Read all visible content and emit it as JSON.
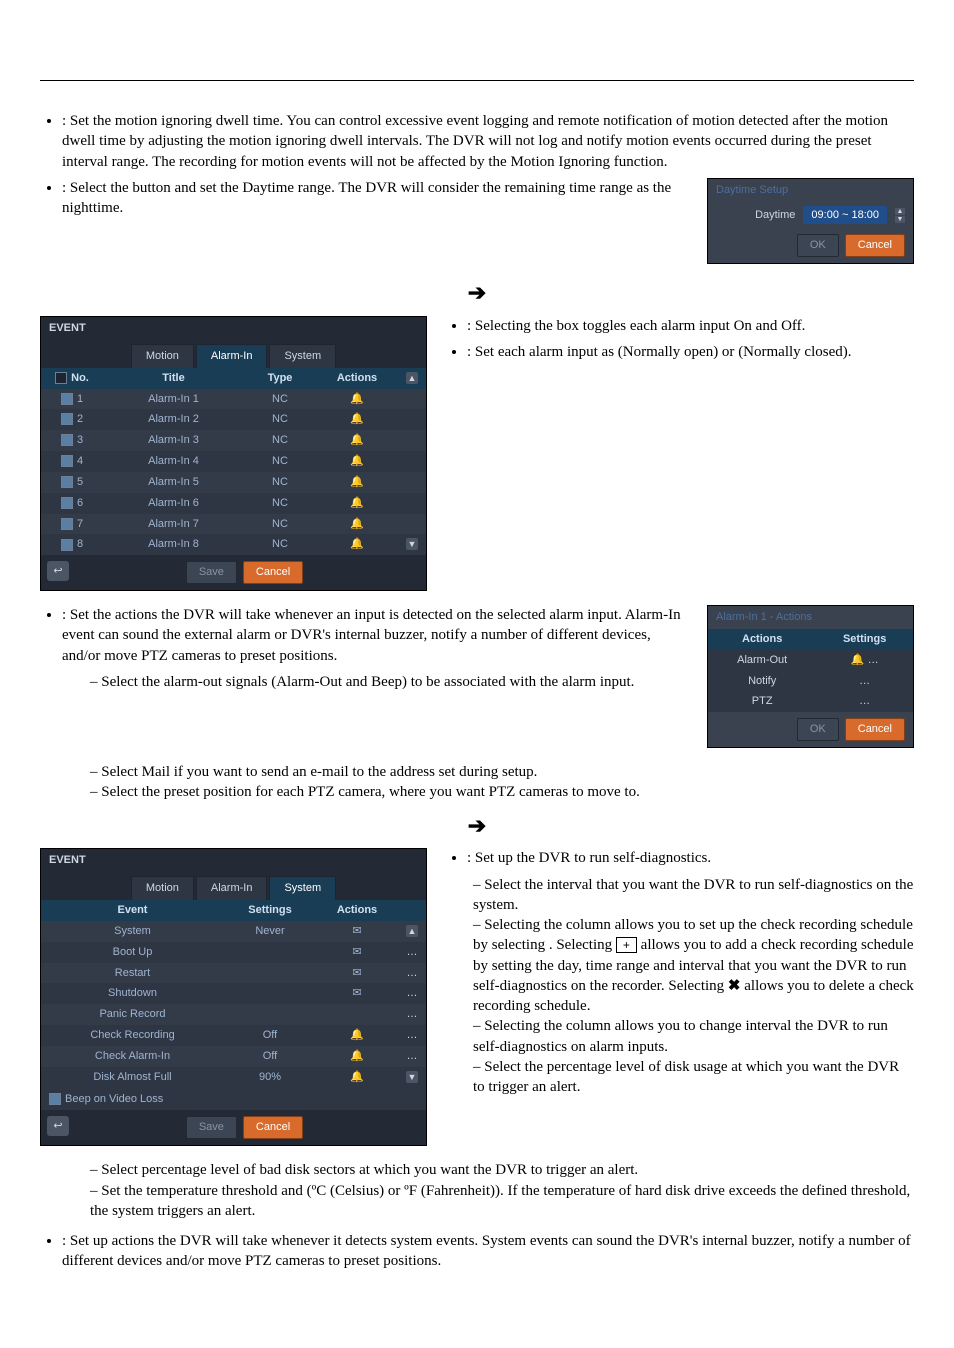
{
  "top": {
    "ignoring_text": ":  Set the motion ignoring dwell time.  You can control excessive event logging and remote notification of motion detected after the motion dwell time by adjusting the motion ignoring dwell intervals.  The DVR will not log and notify motion events occurred during the preset interval range.  The recording for motion events will not be affected by the Motion Ignoring function.",
    "daytime_text": ": Select the button and set the Daytime range.  The DVR will consider the remaining time range as the nighttime."
  },
  "daytime_panel": {
    "title": "Daytime Setup",
    "label": "Daytime",
    "value": "09:00 ~ 18:00",
    "ok": "OK",
    "cancel": "Cancel"
  },
  "alarmin_panel": {
    "title": "EVENT",
    "tabs": [
      "Motion",
      "Alarm-In",
      "System"
    ],
    "active_tab": 1,
    "cols": {
      "no": "No.",
      "title": "Title",
      "type": "Type",
      "actions": "Actions"
    },
    "rows": [
      {
        "no": "1",
        "title": "Alarm-In 1",
        "type": "NC"
      },
      {
        "no": "2",
        "title": "Alarm-In 2",
        "type": "NC"
      },
      {
        "no": "3",
        "title": "Alarm-In 3",
        "type": "NC"
      },
      {
        "no": "4",
        "title": "Alarm-In 4",
        "type": "NC"
      },
      {
        "no": "5",
        "title": "Alarm-In 5",
        "type": "NC"
      },
      {
        "no": "6",
        "title": "Alarm-In 6",
        "type": "NC"
      },
      {
        "no": "7",
        "title": "Alarm-In 7",
        "type": "NC"
      },
      {
        "no": "8",
        "title": "Alarm-In 8",
        "type": "NC"
      }
    ],
    "save": "Save",
    "cancel": "Cancel"
  },
  "alarmin_side": {
    "b1": ":  Selecting the box toggles each alarm input On and Off.",
    "b2a": ":  Set each alarm input as ",
    "b2b": " (Normally open) or ",
    "b2c": " (Normally closed)."
  },
  "actions_text": {
    "lead": ":  Set the actions the DVR will take whenever an input is detected on the selected alarm input.  Alarm-In event can sound the external alarm or DVR's internal buzzer, notify a number of different devices, and/or move PTZ cameras to preset positions.",
    "a1": "– Select the alarm-out signals (Alarm-Out and Beep) to be associated with the alarm input.",
    "a2a": "– Select Mail if you want to send an e-mail to the address set during ",
    "a2b": " setup.",
    "a3": "– Select the preset position for each PTZ camera, where you want PTZ cameras to move to."
  },
  "actions_panel": {
    "title": "Alarm-In 1 - Actions",
    "cols": {
      "actions": "Actions",
      "settings": "Settings"
    },
    "rows": [
      "Alarm-Out",
      "Notify",
      "PTZ"
    ],
    "ok": "OK",
    "cancel": "Cancel"
  },
  "system_panel": {
    "title": "EVENT",
    "tabs": [
      "Motion",
      "Alarm-In",
      "System"
    ],
    "active_tab": 2,
    "cols": {
      "event": "Event",
      "settings": "Settings",
      "actions": "Actions"
    },
    "rows": [
      {
        "event": "System",
        "settings": "Never",
        "icon": "mail"
      },
      {
        "event": "Boot Up",
        "settings": "",
        "icon": "mail"
      },
      {
        "event": "Restart",
        "settings": "",
        "icon": "mail"
      },
      {
        "event": "Shutdown",
        "settings": "",
        "icon": "mail"
      },
      {
        "event": "Panic Record",
        "settings": "",
        "icon": ""
      },
      {
        "event": "Check Recording",
        "settings": "Off",
        "icon": "bell"
      },
      {
        "event": "Check Alarm-In",
        "settings": "Off",
        "icon": "bell"
      },
      {
        "event": "Disk Almost Full",
        "settings": "90%",
        "icon": "bell"
      }
    ],
    "beep_label": "Beep on Video Loss",
    "save": "Save",
    "cancel": "Cancel"
  },
  "system_side": {
    "b1": ":  Set up the DVR to run self-diagnostics.",
    "s1": "– Select the interval that you want the DVR to run self-diagnostics on the system.",
    "s2a": "– Selecting the column allows you to set up the check recording schedule by selecting ",
    "s2b": ".  Selecting ",
    "s2c": " allows you to add a check recording schedule by setting the day, time range and interval that you want the DVR to run self-diagnostics on the recorder.  Selecting ",
    "s2d": " allows you to delete a check recording schedule.",
    "s3": "– Selecting the column allows you to change interval the DVR to run self-diagnostics on alarm inputs.",
    "s4": "– Select the percentage level of disk usage at which you want the DVR to trigger an alert.",
    "s5": "– Select percentage level of bad disk sectors at which you want the DVR to trigger an alert.",
    "s6": "– Set the temperature threshold and (ºC (Celsius) or ºF (Fahrenheit)).  If the temperature of hard disk drive exceeds the defined threshold, the system triggers an alert."
  },
  "bottom": {
    "b": ":  Set up actions the DVR will take whenever it detects system events.  System events can sound the DVR's internal buzzer, notify a number of different devices and/or move PTZ cameras to preset positions."
  }
}
